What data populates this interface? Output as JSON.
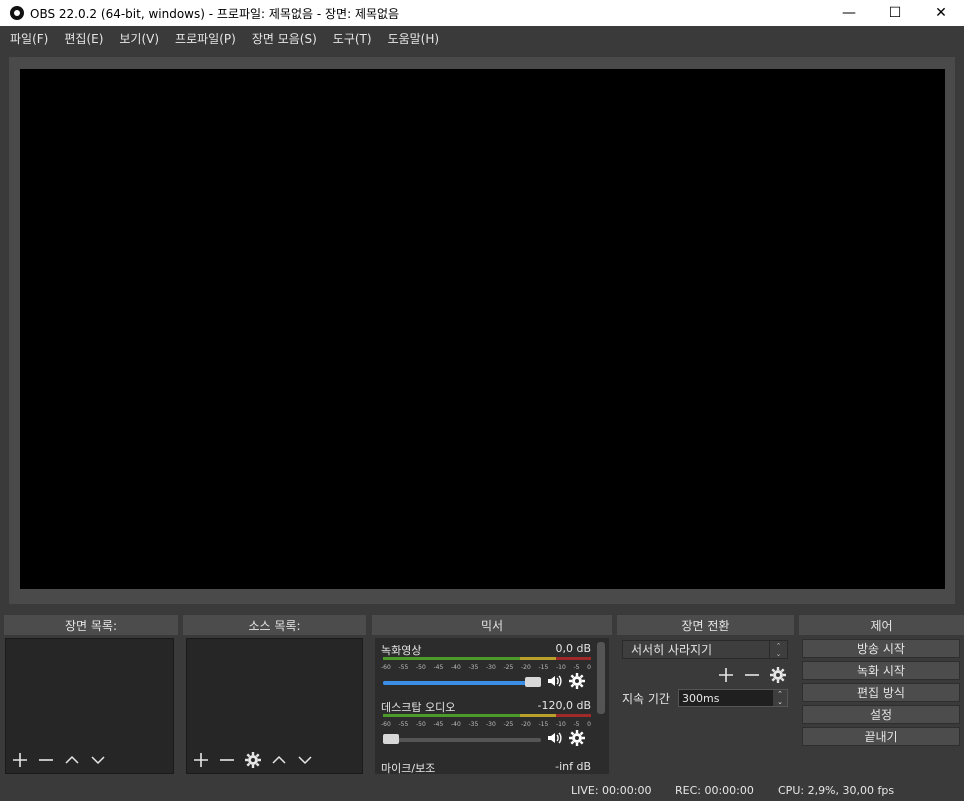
{
  "window": {
    "title": "OBS 22.0.2 (64-bit, windows) - 프로파일: 제목없음 - 장면: 제목없음",
    "minimize": "—",
    "maximize": "☐",
    "close": "✕"
  },
  "menu": [
    "파일(F)",
    "편집(E)",
    "보기(V)",
    "프로파일(P)",
    "장면 모음(S)",
    "도구(T)",
    "도움말(H)"
  ],
  "docks": {
    "scenes_title": "장면 목록:",
    "sources_title": "소스 목록:",
    "mixer_title": "믹서",
    "transitions_title": "장면 전환",
    "controls_title": "제어"
  },
  "mixer": {
    "channels": [
      {
        "name": "녹화영상",
        "db": "0,0 dB",
        "volume": 1.0
      },
      {
        "name": "데스크탑 오디오",
        "db": "-120,0 dB",
        "volume": 0.0
      },
      {
        "name": "마이크/보조",
        "db": "-inf dB"
      }
    ],
    "ticks": [
      "-60",
      "-55",
      "-50",
      "-45",
      "-40",
      "-35",
      "-30",
      "-25",
      "-20",
      "-15",
      "-10",
      "-5",
      "0"
    ]
  },
  "transitions": {
    "selected": "서서히 사라지기",
    "duration_label": "지속 기간",
    "duration_value": "300ms"
  },
  "controls": [
    "방송 시작",
    "녹화 시작",
    "편집 방식",
    "설정",
    "끝내기"
  ],
  "status": {
    "live": "LIVE: 00:00:00",
    "rec": "REC: 00:00:00",
    "cpu": "CPU: 2,9%, 30,00 fps"
  }
}
